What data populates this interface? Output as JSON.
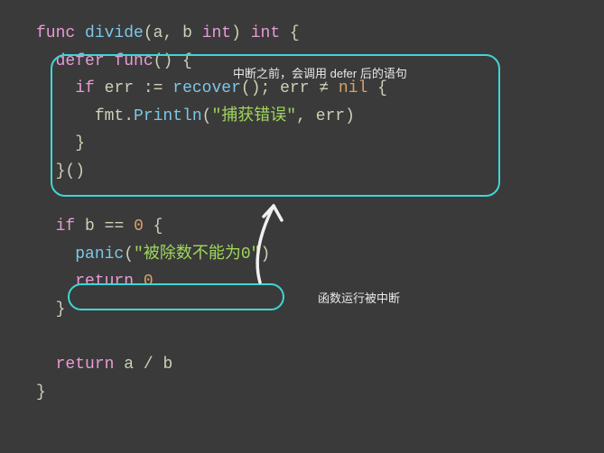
{
  "code": {
    "l1": {
      "func": "func",
      "name": "divide",
      "p1": "a",
      "p2": "b",
      "type": "int",
      "ret": "int"
    },
    "l2": {
      "defer": "defer",
      "func": "func"
    },
    "l3": {
      "if": "if",
      "err": "err",
      "recover": "recover",
      "err2": "err",
      "nil": "nil"
    },
    "l4": {
      "fmt": "fmt",
      "println": "Println",
      "str": "\"捕获错误\"",
      "err": "err"
    },
    "l7": {
      "if": "if",
      "b": "b",
      "zero": "0"
    },
    "l8": {
      "panic": "panic",
      "str": "\"被除数不能为0\""
    },
    "l9": {
      "return": "return",
      "zero": "0"
    },
    "l11": {
      "return": "return",
      "a": "a",
      "b": "b"
    }
  },
  "annotations": {
    "top": "中断之前，会调用 defer 后的语句",
    "bottom": "函数运行被中断"
  }
}
